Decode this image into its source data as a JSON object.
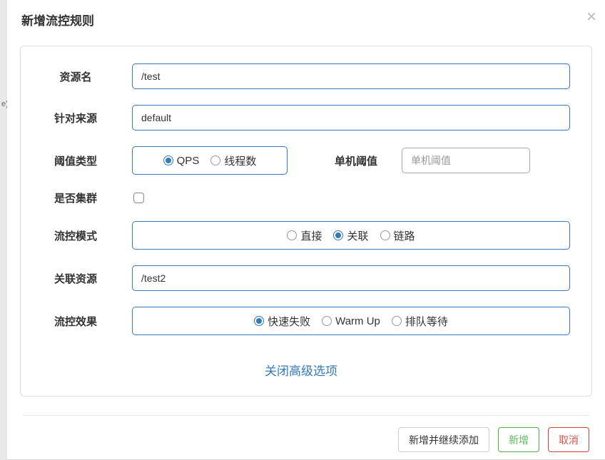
{
  "dialog": {
    "title": "新增流控规则"
  },
  "labels": {
    "resource": "资源名",
    "source": "针对来源",
    "threshold_type": "阈值类型",
    "single_threshold": "单机阈值",
    "cluster": "是否集群",
    "flow_mode": "流控模式",
    "related_resource": "关联资源",
    "flow_effect": "流控效果"
  },
  "fields": {
    "resource_value": "/test",
    "source_value": "default",
    "single_threshold_placeholder": "单机阈值",
    "related_resource_value": "/test2"
  },
  "threshold_type_options": {
    "qps": "QPS",
    "threads": "线程数"
  },
  "flow_mode_options": {
    "direct": "直接",
    "related": "关联",
    "chain": "链路"
  },
  "flow_effect_options": {
    "fast_fail": "快速失败",
    "warm_up": "Warm Up",
    "queue": "排队等待"
  },
  "advanced_link": "关闭高级选项",
  "buttons": {
    "add_continue": "新增并继续添加",
    "add": "新增",
    "cancel": "取消"
  }
}
